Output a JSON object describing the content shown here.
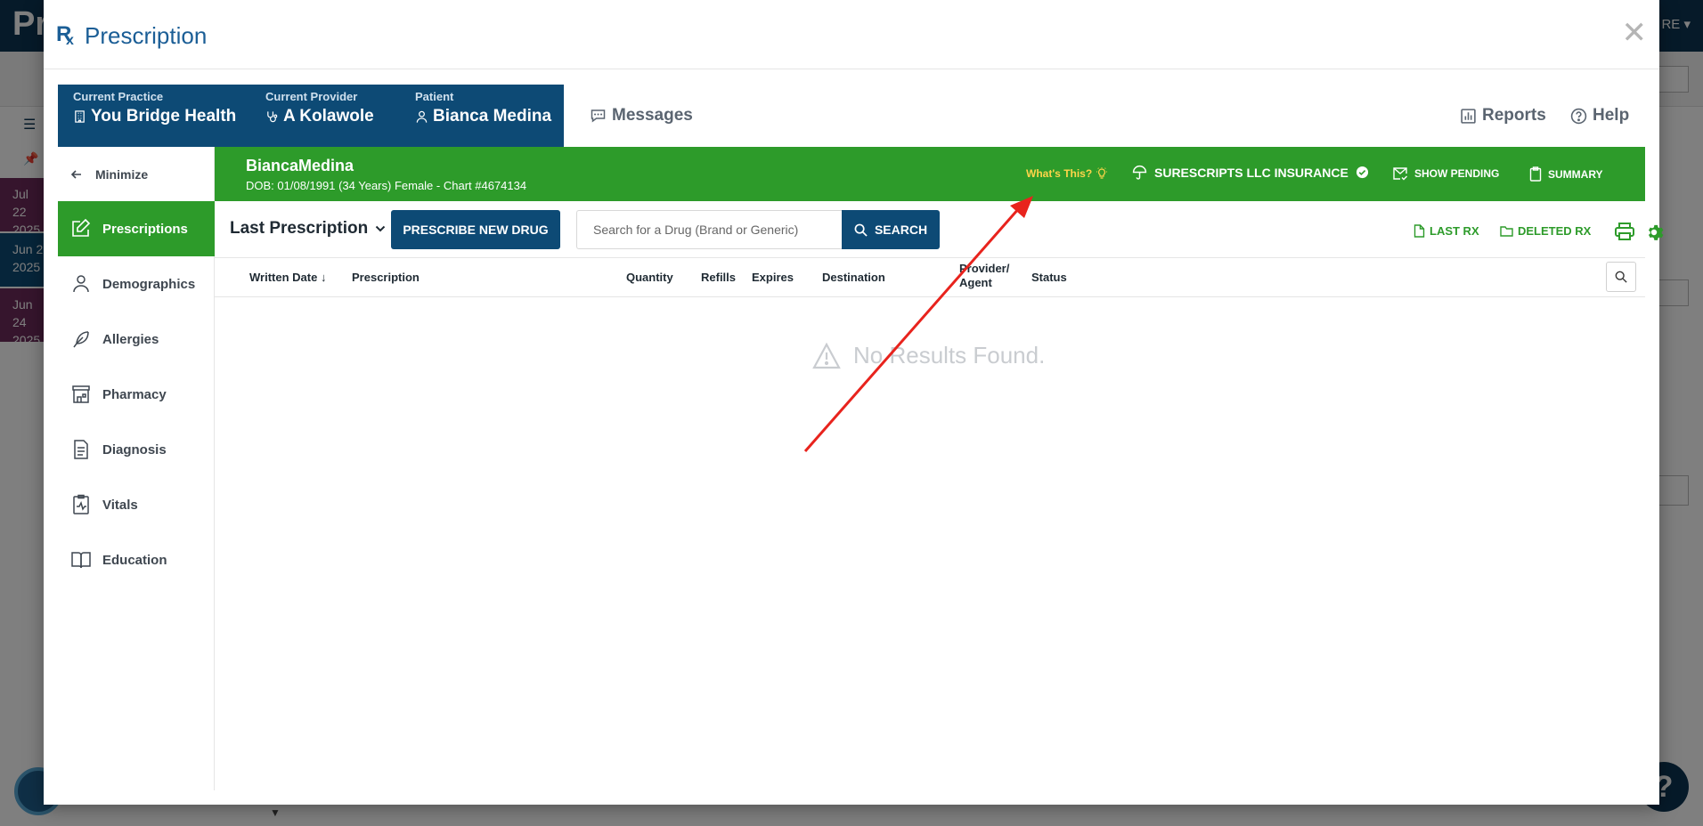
{
  "background_app": {
    "logo": "Pr",
    "topright_label": "RE ▾",
    "rows": [
      {
        "line1": "Jul 22",
        "line2": "2025"
      },
      {
        "line1": "Jun 2",
        "line2": "2025"
      },
      {
        "line1": "Jun 24",
        "line2": "2025"
      }
    ],
    "help_fab": "?"
  },
  "modal": {
    "title": "Prescription",
    "close_label": "✕"
  },
  "context": {
    "practice_label": "Current Practice",
    "practice_value": "You Bridge Health",
    "provider_label": "Current Provider",
    "provider_value": "A Kolawole",
    "patient_label": "Patient",
    "patient_value": "Bianca Medina",
    "messages": "Messages",
    "reports": "Reports",
    "help": "Help"
  },
  "sidebar": {
    "minimize": "Minimize",
    "items": [
      {
        "label": "Prescriptions",
        "icon": "edit-icon",
        "active": true
      },
      {
        "label": "Demographics",
        "icon": "person-icon",
        "active": false
      },
      {
        "label": "Allergies",
        "icon": "feather-icon",
        "active": false
      },
      {
        "label": "Pharmacy",
        "icon": "store-icon",
        "active": false
      },
      {
        "label": "Diagnosis",
        "icon": "document-icon",
        "active": false
      },
      {
        "label": "Vitals",
        "icon": "clipboard-pulse-icon",
        "active": false
      },
      {
        "label": "Education",
        "icon": "book-icon",
        "active": false
      }
    ]
  },
  "banner": {
    "first_name": "Bianca",
    "last_name": "Medina",
    "details": "DOB: 01/08/1991 (34 Years) Female - Chart #4674134",
    "whats_this": "What's This?",
    "insurance": "SURESCRIPTS LLC INSURANCE",
    "show_pending": "SHOW PENDING",
    "summary": "SUMMARY"
  },
  "toolbar": {
    "view_select": "Last Prescription",
    "prescribe_button": "PRESCRIBE NEW DRUG",
    "search_placeholder": "Search for a Drug (Brand or Generic)",
    "search_button": "SEARCH",
    "last_rx": "LAST RX",
    "deleted_rx": "DELETED RX"
  },
  "table": {
    "columns": {
      "written_date": "Written Date",
      "prescription": "Prescription",
      "quantity": "Quantity",
      "refills": "Refills",
      "expires": "Expires",
      "destination": "Destination",
      "provider_line1": "Provider/",
      "provider_line2": "Agent",
      "status": "Status"
    },
    "empty_message": "No Results Found."
  },
  "colors": {
    "navy": "#0d4a75",
    "green": "#2d9b2a",
    "title_blue": "#1b5e96",
    "annotation_red": "#e8231d",
    "warning_yellow": "#ffd54a"
  }
}
